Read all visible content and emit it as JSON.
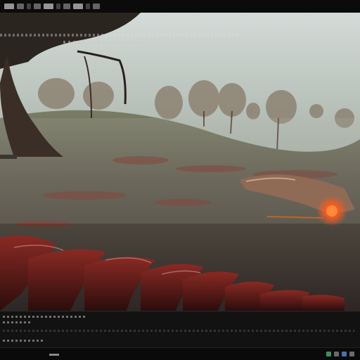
{
  "window": {
    "title_icons": [
      "app-icon",
      "menu-icon",
      "toolbar-icon",
      "toolbar-icon",
      "toolbar-icon",
      "toolbar-icon",
      "toolbar-icon",
      "toolbar-icon",
      "toolbar-icon",
      "toolbar-icon"
    ]
  },
  "scene": {
    "description_icons": [
      "tree",
      "meadow",
      "mechanical-arm",
      "glowing-core",
      "creature-claws"
    ]
  },
  "colors": {
    "sky_top": "#c9d1cf",
    "sky_bottom": "#aeb8b0",
    "ground_far": "#6f7460",
    "ground_near": "#3a2f2c",
    "accent_fire": "#ff5a1f",
    "creature_red": "#6e1c1c",
    "console_bg": "#121212"
  },
  "taskbar": {
    "tray_icons": [
      "network-icon",
      "volume-icon",
      "battery-icon",
      "notification-icon"
    ]
  }
}
